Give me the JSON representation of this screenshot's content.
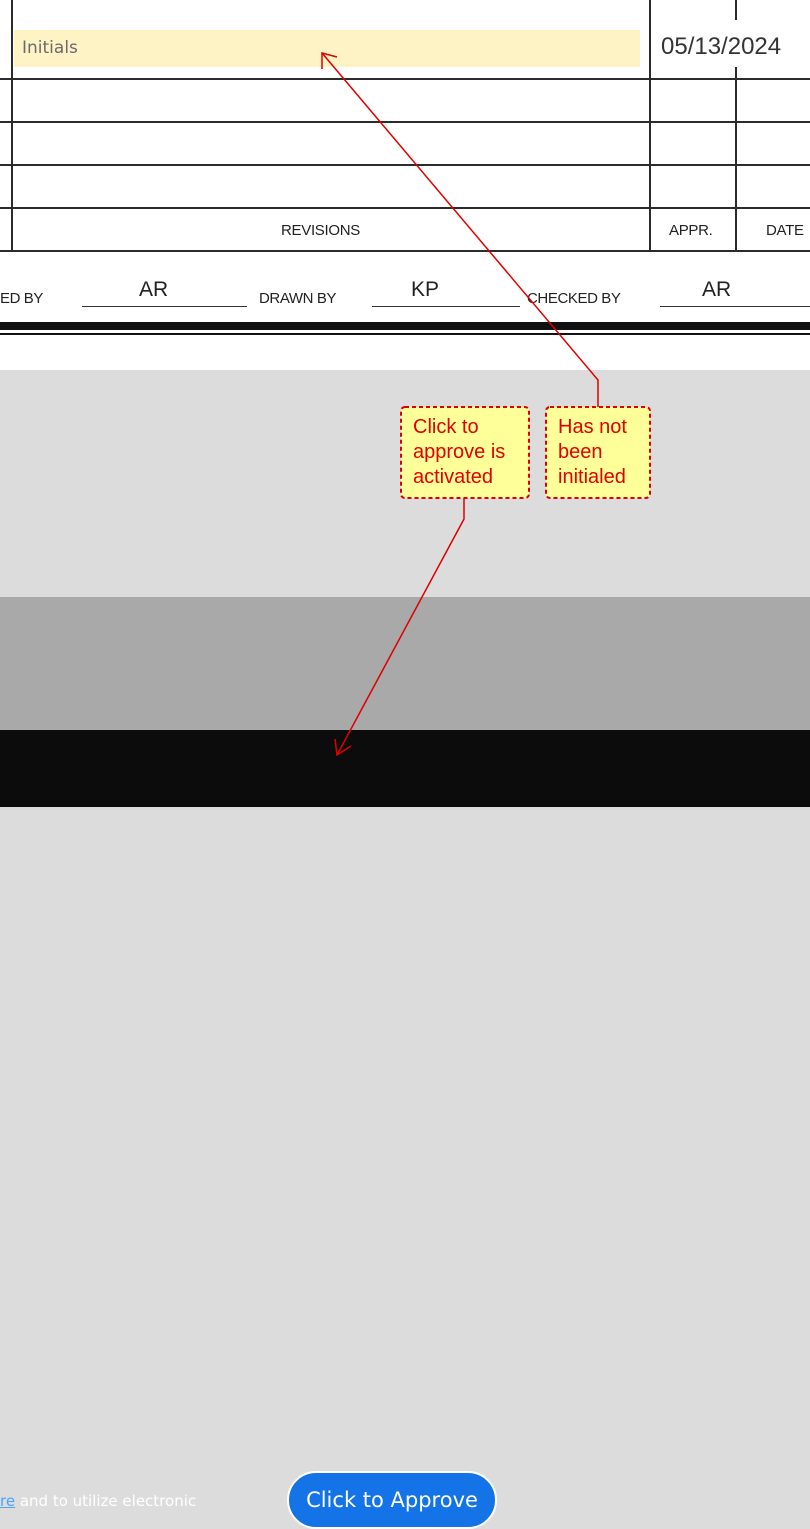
{
  "form": {
    "initials_placeholder": "Initials",
    "date_value": "05/13/2024",
    "headers": {
      "revisions": "REVISIONS",
      "approved": "APPR.",
      "date": "DATE"
    },
    "signatures": {
      "approved_by_label": "ED BY",
      "approved_by_value": "AR",
      "drawn_by_label": "DRAWN BY",
      "drawn_by_value": "KP",
      "checked_by_label": "CHECKED BY",
      "checked_by_value": "AR"
    }
  },
  "annotations": {
    "callout_1": [
      "Click to",
      "approve is",
      "activated"
    ],
    "callout_2": [
      "Has not",
      "been",
      "initialed"
    ],
    "annotation_color": "#e00000",
    "callout_fill": "#ffff99"
  },
  "footer": {
    "consent_link": "re",
    "consent_text": " and to utilize electronic",
    "approve_button": "Click to Approve"
  },
  "colors": {
    "initials_field": "#fdf3c4",
    "approve_button": "#1473e6",
    "bottom_bar": "#0c0c0c"
  }
}
